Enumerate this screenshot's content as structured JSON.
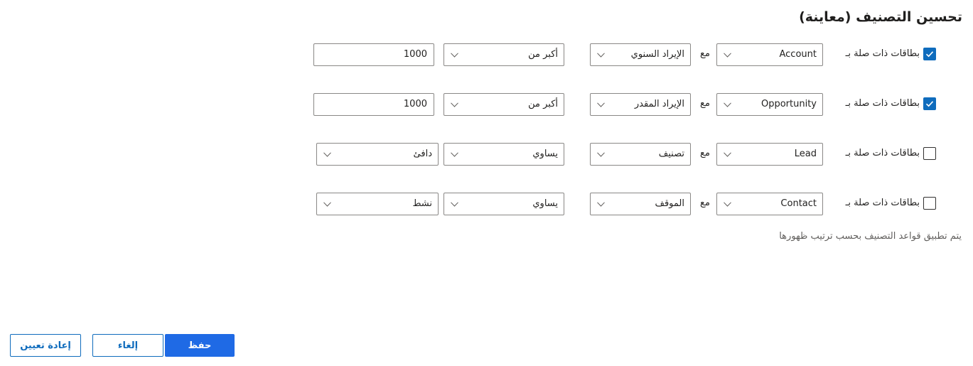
{
  "title": "تحسين التصنيف (معاينة)",
  "rows": [
    {
      "checked": true,
      "label": "بطاقات ذات صلة بـ",
      "entity": "Account",
      "with": "مع",
      "field": "الإيراد السنوي",
      "operator": "أكبر من",
      "value_type": "text",
      "value": "1000"
    },
    {
      "checked": true,
      "label": "بطاقات ذات صلة بـ",
      "entity": "Opportunity",
      "with": "مع",
      "field": "الإيراد المقدر",
      "operator": "أكبر من",
      "value_type": "text",
      "value": "1000"
    },
    {
      "checked": false,
      "label": "بطاقات ذات صلة بـ",
      "entity": "Lead",
      "with": "مع",
      "field": "تصنيف",
      "operator": "يساوي",
      "value_type": "dropdown",
      "value": "دافئ"
    },
    {
      "checked": false,
      "label": "بطاقات ذات صلة بـ",
      "entity": "Contact",
      "with": "مع",
      "field": "الموقف",
      "operator": "يساوي",
      "value_type": "dropdown",
      "value": "نشط"
    }
  ],
  "note": "يتم تطبيق قواعد التصنيف بحسب ترتيب ظهورها",
  "buttons": {
    "save": "حفظ",
    "cancel": "إلغاء",
    "reset": "إعادة تعيين"
  },
  "colors": {
    "accent": "#0f6cbd",
    "primary_button": "#1f6ae5",
    "border": "#8a8886"
  }
}
